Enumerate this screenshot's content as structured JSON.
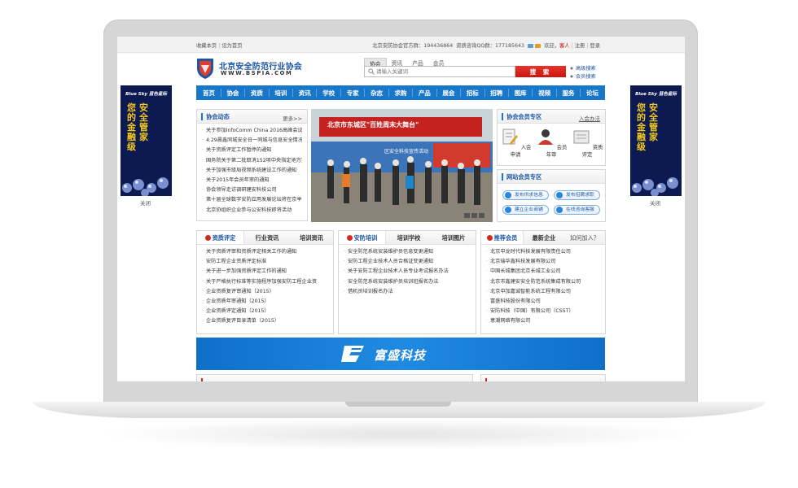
{
  "topbar": {
    "bookmark": "收藏本页",
    "set_home": "设为首页",
    "qq_group": "北京安防协会官方群：194436864",
    "service": "资质咨询QQ群：177185643",
    "welcome": "欢迎，",
    "guest": "客人",
    "register": "注册",
    "login": "登录"
  },
  "header": {
    "org_name": "北京安全防范行业协会",
    "org_url": "WWW.BSPIA.COM"
  },
  "search": {
    "tabs": [
      "协会",
      "资讯",
      "产品",
      "会员"
    ],
    "placeholder": "请输入关键词",
    "button": "搜 索",
    "adv_search": "高级搜索",
    "member_search": "会员搜索"
  },
  "nav": [
    "首页",
    "协会",
    "资质",
    "培训",
    "资讯",
    "学校",
    "专家",
    "杂志",
    "求购",
    "产品",
    "展会",
    "招标",
    "招聘",
    "图库",
    "视频",
    "服务",
    "论坛"
  ],
  "side_ad": {
    "brand": "Blue Sky 蓝色星际",
    "line1": "您的金融级",
    "line2": "安全管家",
    "close": "关闭"
  },
  "association_news": {
    "title": "协会动态",
    "more": "更多>>",
    "items": [
      "关于参加InfoComm China 2016高峰会议及",
      "4.29晨鑫同城安全日一同城与信息安全情况",
      "关于资质评定工作暂停的通知",
      "国务院关于第二批取消152项中央指定地方实",
      "关于加强市级局视频系统建设工作的通知",
      "关于2015年会员年审的通知",
      "协会领导走访调研建安科技公司",
      "第十届全球数字安防应用发展论坛将在京举",
      "北京协组织企业参与公安科技即将活动"
    ]
  },
  "photo": {
    "banner_text": "北京市东城区\"百姓周末大舞台\"",
    "sub_text": "区安全科技宣传活动"
  },
  "member_zone": {
    "title": "协会会员专区",
    "join": "入会办法",
    "items": [
      "入会申请",
      "会员年审",
      "资质评定"
    ]
  },
  "web_member_zone": {
    "title": "网站会员专区",
    "buttons": [
      "发布供求信息",
      "发布招聘求职",
      "建立企业商铺",
      "在线咨询客服"
    ]
  },
  "qualification": {
    "tabs": [
      "资质评定",
      "行业资讯",
      "培训资讯"
    ],
    "items": [
      "关于资质评审和资质评定相关工作的通知",
      "安防工程企业资质评定标准",
      "关于进一步加强资质评定工作的通知",
      "关于严格执行标准等实施程序加强安防工程企业资",
      "企业资质复评审通知（2015）",
      "企业资质年审通知（2015）",
      "企业资质评定通知（2015）",
      "企业资质复评目录清单（2015）"
    ]
  },
  "training": {
    "tabs": [
      "安防培训",
      "培训学校",
      "培训图片"
    ],
    "items": [
      "安全防范系统安装维护员信息变更通知",
      "安防工程企业技术人员合格证变更通知",
      "关于安防工程企业技术人员专业考试报名办法",
      "安全防范系统安装维护员培训班报名办法",
      "借机员培训报名办法"
    ]
  },
  "recommended": {
    "tabs": [
      "推荐会员",
      "最新企业",
      "如何加入？"
    ],
    "items": [
      "北京中龙时代科技发展有限责任公司",
      "北京瑞华鑫科技发展有限公司",
      "中国长城集团北京长城工业公司",
      "北京市鑫建安安全防范系统集成有限公司",
      "北京中加嘉诚智能系统工程有限公司",
      "富盛科技股份有限公司",
      "安防科技（中国）有限公司（CSST）",
      "意潮网络有限公司"
    ]
  },
  "banner": {
    "text": "富盛科技"
  }
}
